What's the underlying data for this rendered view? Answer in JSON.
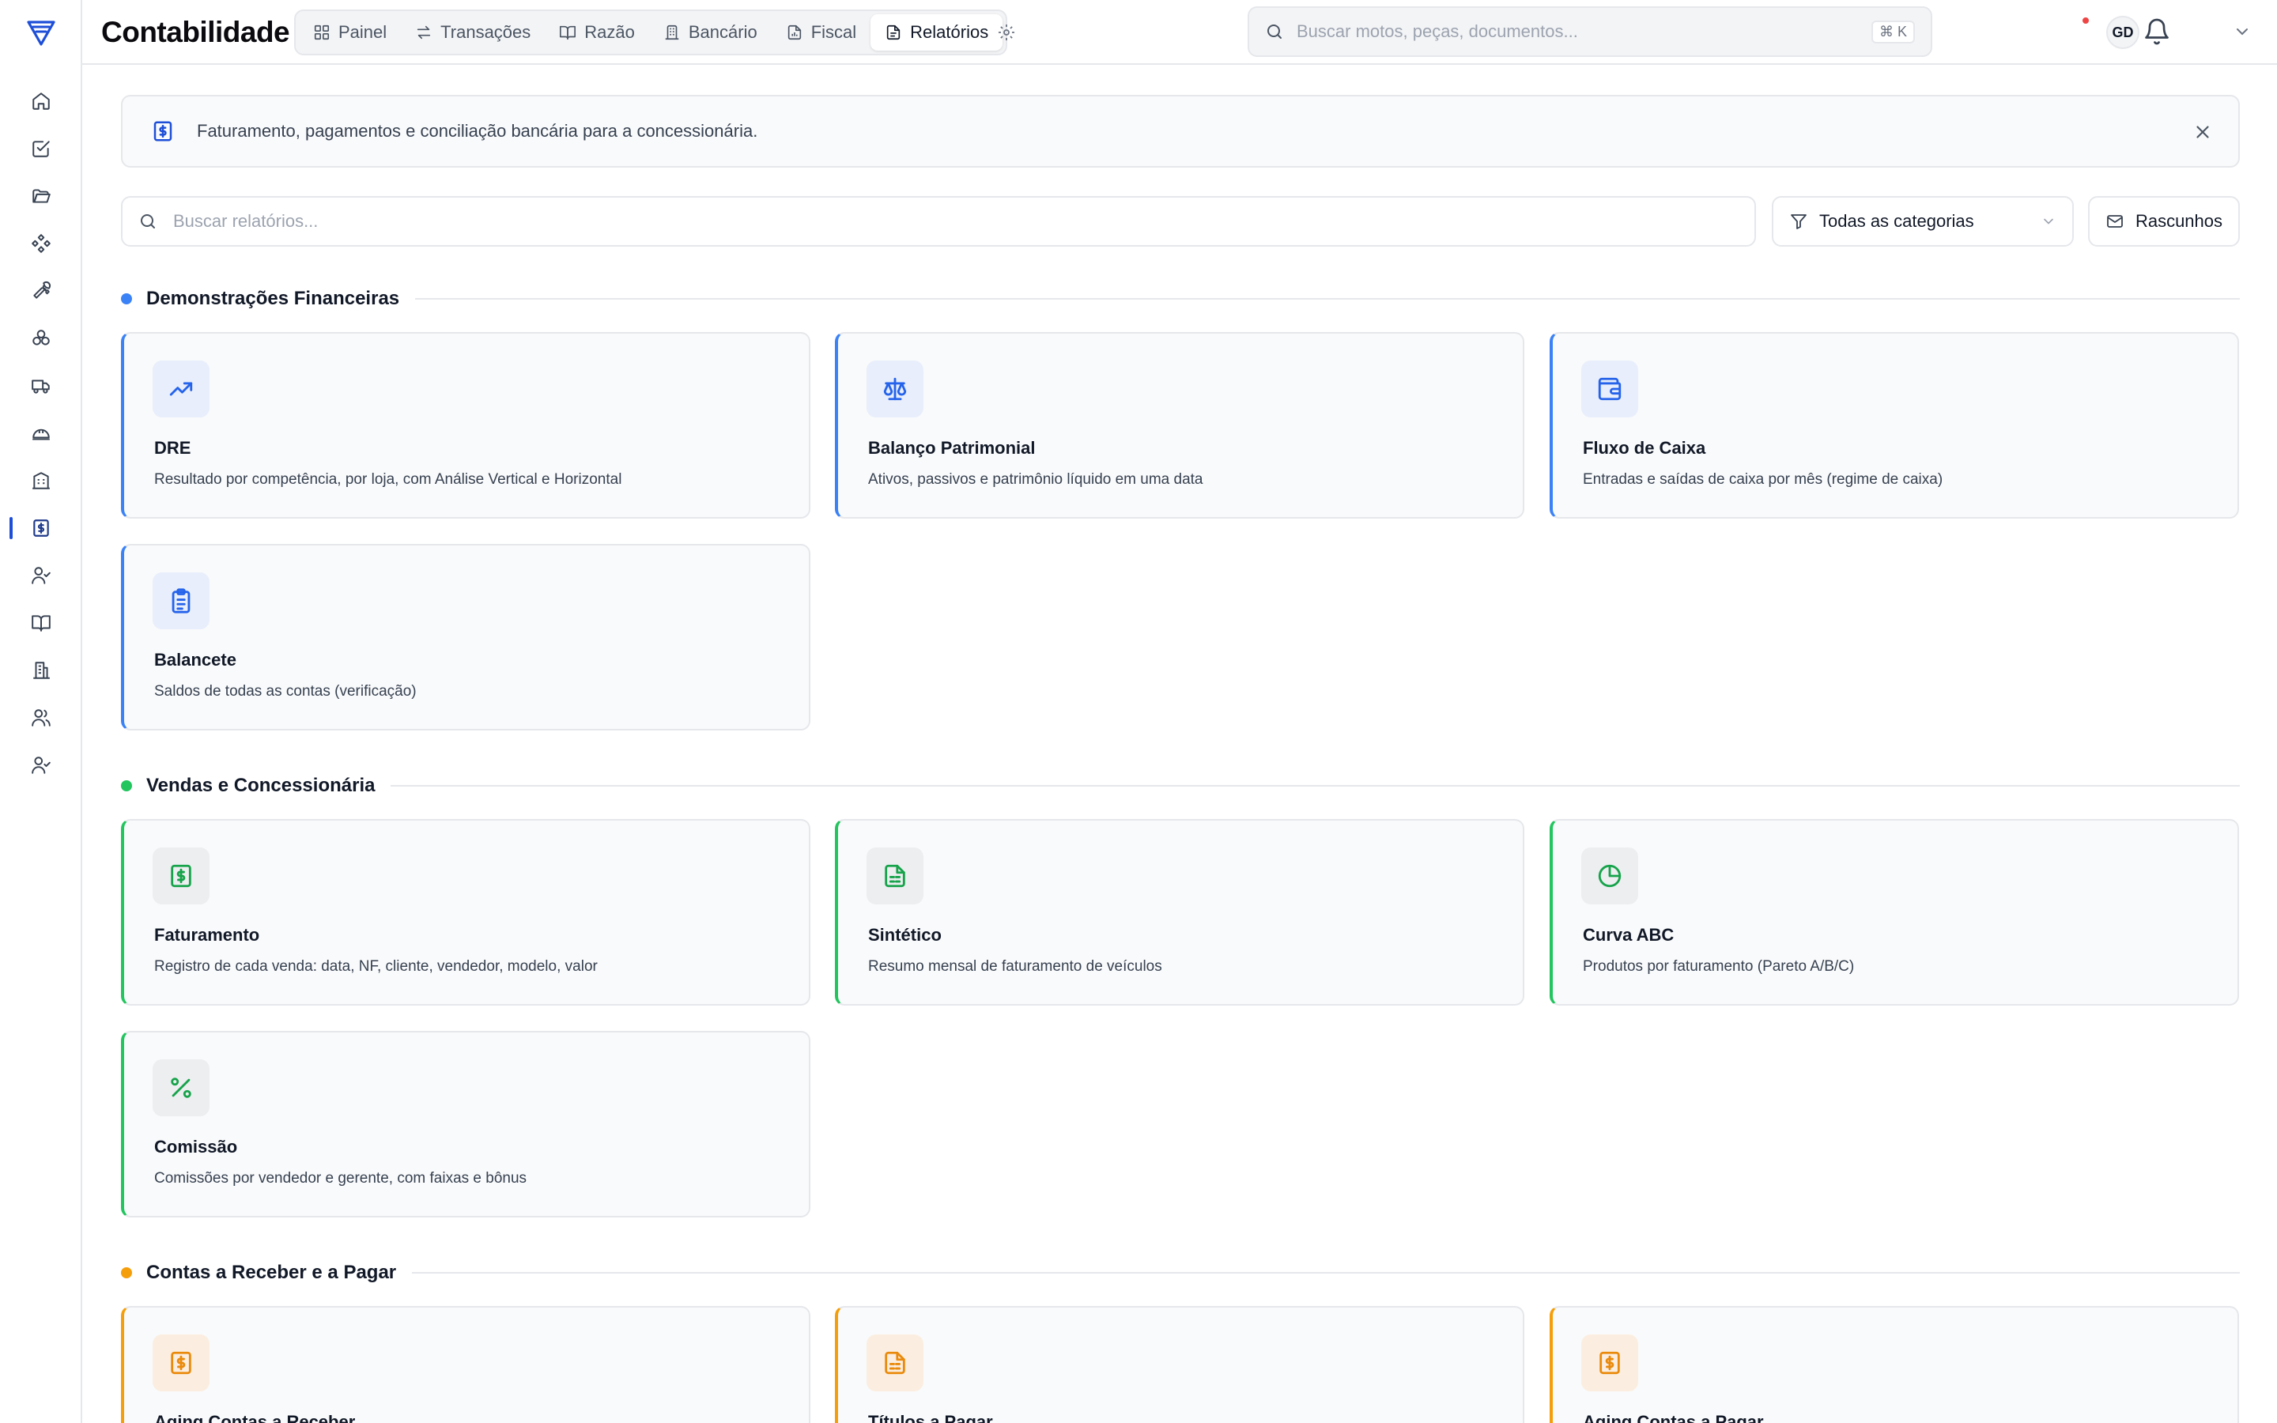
{
  "header": {
    "title": "Contabilidade",
    "tabs": [
      {
        "label": "Painel",
        "icon": "grid-icon"
      },
      {
        "label": "Transações",
        "icon": "arrows-icon"
      },
      {
        "label": "Razão",
        "icon": "book-icon"
      },
      {
        "label": "Bancário",
        "icon": "bank-icon"
      },
      {
        "label": "Fiscal",
        "icon": "file-chart-icon"
      },
      {
        "label": "Relatórios",
        "icon": "file-text-icon",
        "active": true
      }
    ],
    "search_placeholder": "Buscar motos, peças, documentos...",
    "search_shortcut": "⌘ K",
    "avatar_initials": "GD"
  },
  "sidebar": {
    "items": [
      {
        "icon": "home-icon"
      },
      {
        "icon": "check-square-icon"
      },
      {
        "icon": "folder-open-icon"
      },
      {
        "icon": "diamond-grid-icon"
      },
      {
        "icon": "wrench-icon"
      },
      {
        "icon": "parts-icon"
      },
      {
        "icon": "truck-icon"
      },
      {
        "icon": "helmet-icon"
      },
      {
        "icon": "building-icon"
      },
      {
        "icon": "dollar-receipt-icon",
        "active": true
      },
      {
        "icon": "user-check-icon"
      },
      {
        "icon": "open-book-icon"
      },
      {
        "icon": "office-icon"
      },
      {
        "icon": "users-icon"
      },
      {
        "icon": "user-check-2-icon"
      }
    ]
  },
  "banner": {
    "text": "Faturamento, pagamentos e conciliação bancária para a concessionária."
  },
  "filters": {
    "search_placeholder": "Buscar relatórios...",
    "category_value": "Todas as categorias",
    "drafts_label": "Rascunhos"
  },
  "colors": {
    "blue": "#3b82f6",
    "green": "#22c55e",
    "amber": "#f59e0b"
  },
  "sections": [
    {
      "title": "Demonstrações Financeiras",
      "color": "blue",
      "cards": [
        {
          "title": "DRE",
          "desc": "Resultado por competência, por loja, com Análise Vertical e Horizontal",
          "icon": "trending-up-icon"
        },
        {
          "title": "Balanço Patrimonial",
          "desc": "Ativos, passivos e patrimônio líquido em uma data",
          "icon": "scale-icon"
        },
        {
          "title": "Fluxo de Caixa",
          "desc": "Entradas e saídas de caixa por mês (regime de caixa)",
          "icon": "wallet-icon"
        },
        {
          "title": "Balancete",
          "desc": "Saldos de todas as contas (verificação)",
          "icon": "clipboard-list-icon"
        }
      ]
    },
    {
      "title": "Vendas e Concessionária",
      "color": "green",
      "cards": [
        {
          "title": "Faturamento",
          "desc": "Registro de cada venda: data, NF, cliente, vendedor, modelo, valor",
          "icon": "dollar-receipt-icon"
        },
        {
          "title": "Sintético",
          "desc": "Resumo mensal de faturamento de veículos",
          "icon": "file-spreadsheet-icon"
        },
        {
          "title": "Curva ABC",
          "desc": "Produtos por faturamento (Pareto A/B/C)",
          "icon": "pie-chart-icon"
        },
        {
          "title": "Comissão",
          "desc": "Comissões por vendedor e gerente, com faixas e bônus",
          "icon": "percent-icon"
        }
      ]
    },
    {
      "title": "Contas a Receber e a Pagar",
      "color": "amber",
      "cards": [
        {
          "title": "Aging Contas a Receber",
          "desc": "",
          "icon": "dollar-receipt-icon"
        },
        {
          "title": "Títulos a Pagar",
          "desc": "",
          "icon": "file-spreadsheet-icon"
        },
        {
          "title": "Aging Contas a Pagar",
          "desc": "",
          "icon": "dollar-receipt-icon"
        }
      ]
    }
  ]
}
